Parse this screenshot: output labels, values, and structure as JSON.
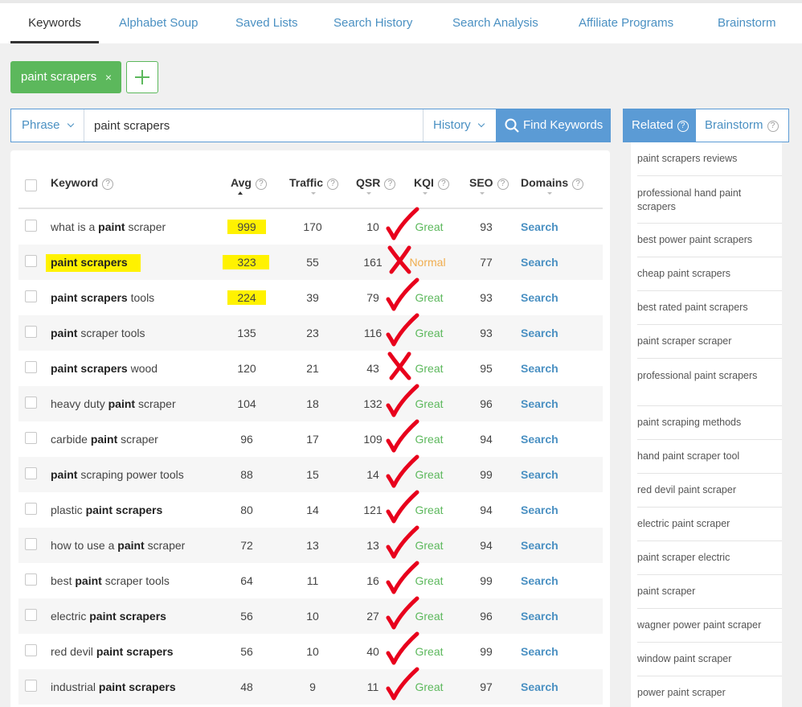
{
  "nav": {
    "tabs": [
      "Keywords",
      "Alphabet Soup",
      "Saved Lists",
      "Search History",
      "Search Analysis",
      "Affiliate Programs",
      "Brainstorm"
    ],
    "active": "Keywords"
  },
  "chips": [
    {
      "label": "paint scrapers",
      "close": "×"
    }
  ],
  "search": {
    "mode": "Phrase",
    "query": "paint scrapers",
    "history_label": "History",
    "find_label": "Find Keywords"
  },
  "table": {
    "headers": {
      "keyword": "Keyword",
      "avg": "Avg",
      "traffic": "Traffic",
      "qsr": "QSR",
      "kqi": "KQI",
      "seo": "SEO",
      "domains": "Domains"
    },
    "help_glyph": "?",
    "rows": [
      {
        "pre": "what is a ",
        "bold": "paint",
        "post": " scraper",
        "avg": "999",
        "traffic": "170",
        "qsr": "10",
        "kqi": "Great",
        "seo": "93",
        "action": "Search"
      },
      {
        "pre": "",
        "bold": "paint scrapers",
        "post": "",
        "avg": "323",
        "traffic": "55",
        "qsr": "161",
        "kqi": "Normal",
        "seo": "77",
        "action": "Search"
      },
      {
        "pre": "",
        "bold": "paint scrapers",
        "post": " tools",
        "avg": "224",
        "traffic": "39",
        "qsr": "79",
        "kqi": "Great",
        "seo": "93",
        "action": "Search"
      },
      {
        "pre": "",
        "bold": "paint",
        "post": " scraper tools",
        "avg": "135",
        "traffic": "23",
        "qsr": "116",
        "kqi": "Great",
        "seo": "93",
        "action": "Search"
      },
      {
        "pre": "",
        "bold": "paint scrapers",
        "post": " wood",
        "avg": "120",
        "traffic": "21",
        "qsr": "43",
        "kqi": "Great",
        "seo": "95",
        "action": "Search"
      },
      {
        "pre": "heavy duty ",
        "bold": "paint",
        "post": " scraper",
        "avg": "104",
        "traffic": "18",
        "qsr": "132",
        "kqi": "Great",
        "seo": "96",
        "action": "Search"
      },
      {
        "pre": "carbide ",
        "bold": "paint",
        "post": " scraper",
        "avg": "96",
        "traffic": "17",
        "qsr": "109",
        "kqi": "Great",
        "seo": "94",
        "action": "Search"
      },
      {
        "pre": "",
        "bold": "paint",
        "post": " scraping power tools",
        "avg": "88",
        "traffic": "15",
        "qsr": "14",
        "kqi": "Great",
        "seo": "99",
        "action": "Search"
      },
      {
        "pre": "plastic ",
        "bold": "paint scrapers",
        "post": "",
        "avg": "80",
        "traffic": "14",
        "qsr": "121",
        "kqi": "Great",
        "seo": "94",
        "action": "Search"
      },
      {
        "pre": "how to use a ",
        "bold": "paint",
        "post": " scraper",
        "avg": "72",
        "traffic": "13",
        "qsr": "13",
        "kqi": "Great",
        "seo": "94",
        "action": "Search"
      },
      {
        "pre": "best ",
        "bold": "paint",
        "post": " scraper tools",
        "avg": "64",
        "traffic": "11",
        "qsr": "16",
        "kqi": "Great",
        "seo": "99",
        "action": "Search"
      },
      {
        "pre": "electric ",
        "bold": "paint scrapers",
        "post": "",
        "avg": "56",
        "traffic": "10",
        "qsr": "27",
        "kqi": "Great",
        "seo": "96",
        "action": "Search"
      },
      {
        "pre": "red devil ",
        "bold": "paint scrapers",
        "post": "",
        "avg": "56",
        "traffic": "10",
        "qsr": "40",
        "kqi": "Great",
        "seo": "99",
        "action": "Search"
      },
      {
        "pre": "industrial ",
        "bold": "paint scrapers",
        "post": "",
        "avg": "48",
        "traffic": "9",
        "qsr": "11",
        "kqi": "Great",
        "seo": "97",
        "action": "Search"
      }
    ]
  },
  "related": {
    "tabs": [
      "Related",
      "Brainstorm"
    ],
    "items": [
      "paint scrapers reviews",
      "professional hand paint scrapers",
      "best power paint scrapers",
      "cheap paint scrapers",
      "best rated paint scrapers",
      "paint scraper scraper",
      "professional paint scrapers",
      "paint scraping methods",
      "hand paint scraper tool",
      "red devil paint scraper",
      "electric paint scraper",
      "paint scraper electric",
      "paint scraper",
      "wagner power paint scraper",
      "window paint scraper",
      "power paint scraper"
    ]
  },
  "colors": {
    "accent": "#5b9bd5",
    "chip": "#5cb85c",
    "great": "#5cb85c",
    "normal": "#f0ad4e",
    "highlight": "#fff200",
    "ink": "#e8001c"
  }
}
